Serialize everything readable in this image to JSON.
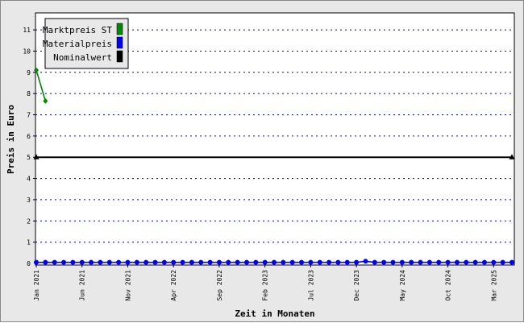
{
  "chart_data": {
    "type": "line",
    "xlabel": "Zeit in Monaten",
    "ylabel": "Preis in Euro",
    "ylim": [
      0,
      11.8
    ],
    "yticks": [
      1,
      2,
      3,
      4,
      5,
      6,
      7,
      8,
      9,
      10,
      11
    ],
    "grid": "horizontal dotted",
    "legend_position": "top-left",
    "x_tick_labels": [
      {
        "index": 0,
        "label": "Jan 2021"
      },
      {
        "index": 5,
        "label": "Jun 2021"
      },
      {
        "index": 10,
        "label": "Nov 2021"
      },
      {
        "index": 15,
        "label": "Apr 2022"
      },
      {
        "index": 20,
        "label": "Sep 2022"
      },
      {
        "index": 25,
        "label": "Feb 2023"
      },
      {
        "index": 30,
        "label": "Jul 2023"
      },
      {
        "index": 35,
        "label": "Dec 2023"
      },
      {
        "index": 40,
        "label": "May 2024"
      },
      {
        "index": 45,
        "label": "Oct 2024"
      },
      {
        "index": 50,
        "label": "Mar 2025"
      }
    ],
    "x_count": 53,
    "series": [
      {
        "name": "Marktpreis ST",
        "color": "#008800",
        "marker": "diamond",
        "x_index": [
          0,
          1
        ],
        "values": [
          9.1,
          7.65
        ]
      },
      {
        "name": "Materialpreis",
        "color": "#0000ff",
        "marker": "circle",
        "x_index_start": 0,
        "values": [
          0.05,
          0.05,
          0.05,
          0.05,
          0.05,
          0.05,
          0.05,
          0.05,
          0.05,
          0.05,
          0.05,
          0.05,
          0.05,
          0.05,
          0.05,
          0.05,
          0.05,
          0.05,
          0.05,
          0.05,
          0.05,
          0.05,
          0.05,
          0.05,
          0.05,
          0.05,
          0.05,
          0.05,
          0.05,
          0.05,
          0.05,
          0.05,
          0.05,
          0.05,
          0.05,
          0.05,
          0.1,
          0.05,
          0.05,
          0.05,
          0.05,
          0.05,
          0.05,
          0.05,
          0.05,
          0.05,
          0.05,
          0.05,
          0.05,
          0.05,
          0.05,
          0.05,
          0.05
        ]
      },
      {
        "name": "Nominalwert",
        "color": "#000000",
        "marker": "triangle",
        "x_index": [
          0,
          52
        ],
        "values": [
          5,
          5
        ]
      }
    ]
  }
}
